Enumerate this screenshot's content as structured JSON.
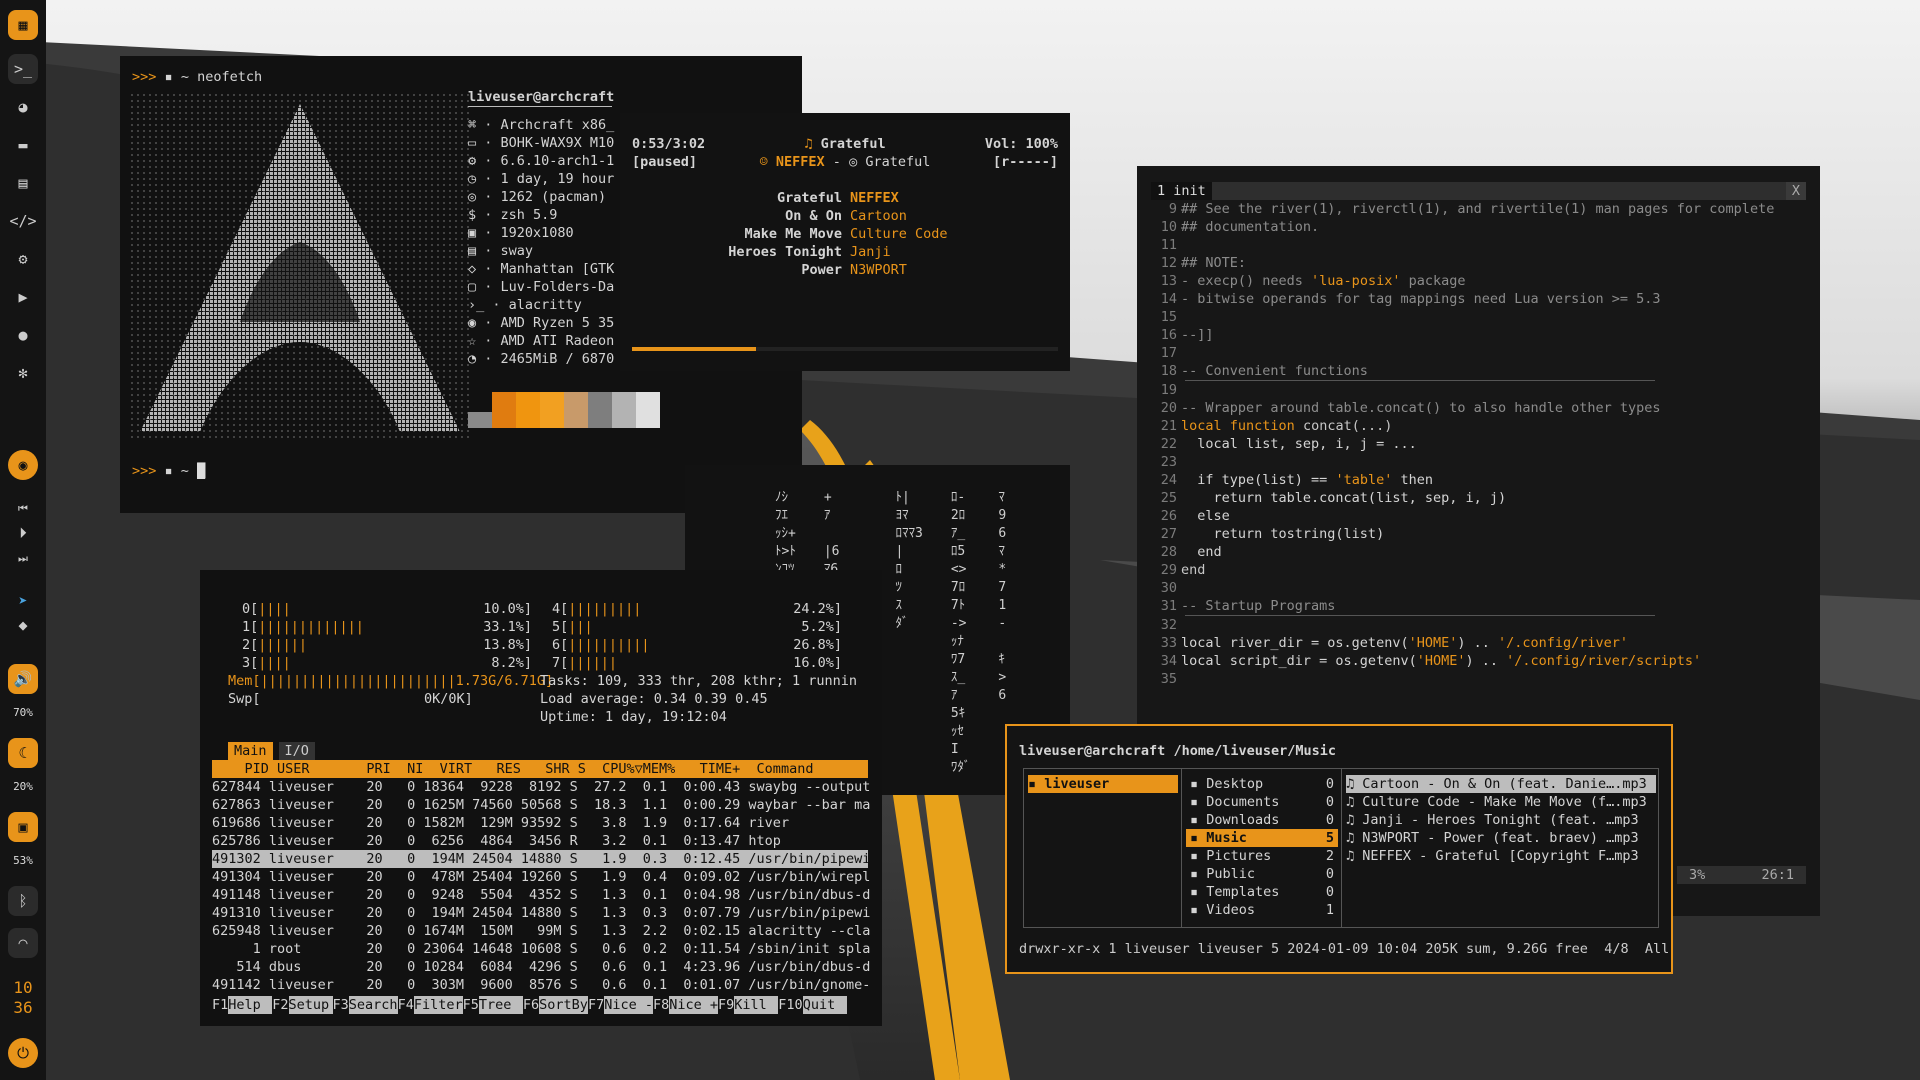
{
  "sidebar": {
    "vol_percent": "70%",
    "bright_percent": "20%",
    "lock_percent": "53%",
    "clock_hour": "10",
    "clock_min": "36",
    "icons": [
      "grid-icon",
      "terminal-icon",
      "firefox-icon",
      "folder-icon",
      "file-icon",
      "code-icon",
      "settings-icon",
      "youtube-icon",
      "github-icon",
      "gear-icon",
      "palette-icon",
      "prev-icon",
      "play-icon",
      "next-icon",
      "telegram-icon",
      "diamond-icon",
      "volume-icon",
      "moon-icon",
      "lock-icon",
      "bluetooth-icon",
      "wifi-icon",
      "power-icon"
    ]
  },
  "neofetch": {
    "prompt": ">>>",
    "cmd": "~ neofetch",
    "host": "liveuser@archcraft",
    "lines": [
      "Archcraft x86_",
      "BOHK-WAX9X M10",
      "6.6.10-arch1-1",
      "1 day, 19 hour",
      "1262 (pacman)",
      "zsh 5.9",
      "1920x1080",
      "sway",
      "Manhattan [GTK",
      "Luv-Folders-Da",
      "alacritty",
      "AMD Ryzen 5 35",
      "AMD ATI Radeon",
      "2465MiB / 6870"
    ],
    "icons": [
      "⌘",
      "▭",
      "⚙",
      "◷",
      "◎",
      "$",
      "▣",
      "▤",
      "◇",
      "▢",
      "›_",
      "◉",
      "☆",
      "◔"
    ],
    "prompt2": ">>> ▪ ~",
    "colors": [
      "#8a8a8a",
      "#e07c10",
      "#f0950f",
      "#f2a021",
      "#c89a6a",
      "#7e7e7e",
      "#b3b3b3",
      "#e0e0e0"
    ]
  },
  "music": {
    "time": "0:53/3:02",
    "state": "[paused]",
    "title": "Grateful",
    "artist": "NEFFEX",
    "album": "Grateful",
    "vol": "Vol: 100%",
    "mode": "[r-----]",
    "tracks": [
      {
        "t": "Grateful",
        "a": "NEFFEX"
      },
      {
        "t": "On & On",
        "a": "Cartoon"
      },
      {
        "t": "Make Me Move",
        "a": "Culture Code"
      },
      {
        "t": "Heroes Tonight",
        "a": "Janji"
      },
      {
        "t": "Power",
        "a": "N3WPORT"
      }
    ],
    "progress": 0.29
  },
  "editor": {
    "tab": "1 init",
    "close": "X",
    "status_pct": "3%",
    "status_pos": "26:1",
    "lines": [
      {
        "n": "9",
        "c": "## See the river(1), riverctl(1), and rivertile(1) man pages for complete",
        "k": "cm"
      },
      {
        "n": "10",
        "c": "## documentation.",
        "k": "cm"
      },
      {
        "n": "11",
        "c": "",
        "k": ""
      },
      {
        "n": "12",
        "c": "## NOTE:",
        "k": "cm"
      },
      {
        "n": "13",
        "c": "- execp() needs 'lua-posix' package",
        "k": "cm"
      },
      {
        "n": "14",
        "c": "- bitwise operands for tag mappings need Lua version >= 5.3",
        "k": "cm"
      },
      {
        "n": "15",
        "c": "",
        "k": ""
      },
      {
        "n": "16",
        "c": "--]]",
        "k": "cm"
      },
      {
        "n": "17",
        "c": "",
        "k": ""
      },
      {
        "n": "18",
        "c": "-- Convenient functions",
        "k": "cm"
      },
      {
        "n": "19",
        "c": "",
        "k": ""
      },
      {
        "n": "20",
        "c": "-- Wrapper around table.concat() to also handle other types",
        "k": "cm"
      },
      {
        "n": "21",
        "c": "local function concat(...)",
        "k": "fn"
      },
      {
        "n": "22",
        "c": "  local list, sep, i, j = ...",
        "k": ""
      },
      {
        "n": "23",
        "c": "",
        "k": ""
      },
      {
        "n": "24",
        "c": "  if type(list) == 'table' then",
        "k": ""
      },
      {
        "n": "25",
        "c": "    return table.concat(list, sep, i, j)",
        "k": ""
      },
      {
        "n": "26",
        "c": "  else",
        "k": ""
      },
      {
        "n": "27",
        "c": "    return tostring(list)",
        "k": ""
      },
      {
        "n": "28",
        "c": "  end",
        "k": ""
      },
      {
        "n": "29",
        "c": "end",
        "k": "kwl"
      },
      {
        "n": "30",
        "c": "",
        "k": ""
      },
      {
        "n": "31",
        "c": "-- Startup Programs",
        "k": "cm"
      },
      {
        "n": "32",
        "c": "",
        "k": ""
      },
      {
        "n": "33",
        "c": "local river_dir = os.getenv('HOME') .. '/.config/river'",
        "k": ""
      },
      {
        "n": "34",
        "c": "local script_dir = os.getenv('HOME') .. '/.config/river/scripts'",
        "k": ""
      },
      {
        "n": "35",
        "c": "",
        "k": ""
      }
    ]
  },
  "matrix": {
    "cols": [
      "ﾉｼ\nﾌｴ\nｯｼ+\nﾄ>ﾄ\nﾝｺﾂ",
      "+\nｱ\n\n|6\nﾏ6",
      "",
      "ﾄ|\nﾖﾏ\nﾛﾏﾏ3\n|\nﾛ\nﾂ\nｽ\nﾀﾞ",
      "ﾛ-\n2ﾛ\nｱ_\nﾛ5\n<>\n7ﾛ\n7ﾄ\n->\nｯﾅ\nﾜ7\nｽ_\nｱ\n5ｷ\nｯｾ\nI\nﾜﾀﾞ",
      "ﾏ\n9\n6\nﾏ\n*\n7\n1\n-\n\nｷ\n>\n6"
    ]
  },
  "htop": {
    "cpus": [
      {
        "id": "0",
        "bar": "||||",
        "pct": "10.0%"
      },
      {
        "id": "1",
        "bar": "|||||||||||||",
        "pct": "33.1%"
      },
      {
        "id": "2",
        "bar": "||||||",
        "pct": "13.8%"
      },
      {
        "id": "3",
        "bar": "||||",
        "pct": "8.2%"
      },
      {
        "id": "4",
        "bar": "|||||||||",
        "pct": "24.2%"
      },
      {
        "id": "5",
        "bar": "|||",
        "pct": "5.2%"
      },
      {
        "id": "6",
        "bar": "||||||||||",
        "pct": "26.8%"
      },
      {
        "id": "7",
        "bar": "||||||",
        "pct": "16.0%"
      }
    ],
    "mem": "Mem[||||||||||||||||||||||||1.73G/6.71G]",
    "swp": "Swp[",
    "swp_val": "0K/0K]",
    "tasks": "Tasks: 109, 333 thr, 208 kthr; 1 runnin",
    "load": "Load average: 0.34 0.39 0.45",
    "uptime": "Uptime: 1 day, 19:12:04",
    "tabs": [
      "Main",
      "I/O"
    ],
    "header": "    PID USER       PRI  NI  VIRT   RES   SHR S  CPU%▽MEM%   TIME+  Command",
    "rows": [
      "627844 liveuser    20   0 18364  9228  8192 S  27.2  0.1  0:00.43 swaybg --output",
      "627863 liveuser    20   0 1625M 74560 50568 S  18.3  1.1  0:00.29 waybar --bar ma",
      "619686 liveuser    20   0 1582M  129M 93592 S   3.8  1.9  0:17.64 river",
      "625786 liveuser    20   0  6256  4864  3456 R   3.2  0.1  0:13.47 htop",
      "491302 liveuser    20   0  194M 24504 14880 S   1.9  0.3  0:12.45 /usr/bin/pipewi",
      "491304 liveuser    20   0  478M 25404 19260 S   1.9  0.4  0:09.02 /usr/bin/wirepl",
      "491148 liveuser    20   0  9248  5504  4352 S   1.3  0.1  0:04.98 /usr/bin/dbus-d",
      "491310 liveuser    20   0  194M 24504 14880 S   1.3  0.3  0:07.79 /usr/bin/pipewi",
      "625948 liveuser    20   0 1674M  150M   99M S   1.3  2.2  0:02.15 alacritty --cla",
      "     1 root        20   0 23064 14648 10608 S   0.6  0.2  0:11.54 /sbin/init spla",
      "   514 dbus        20   0 10284  6084  4296 S   0.6  0.1  4:23.96 /usr/bin/dbus-d",
      "491142 liveuser    20   0  303M  9600  8576 S   0.6  0.1  0:01.07 /usr/bin/gnome-"
    ],
    "fkeys": [
      [
        "F1",
        "Help"
      ],
      [
        "F2",
        "Setup"
      ],
      [
        "F3",
        "Search"
      ],
      [
        "F4",
        "Filter"
      ],
      [
        "F5",
        "Tree"
      ],
      [
        "F6",
        "SortBy"
      ],
      [
        "F7",
        "Nice -"
      ],
      [
        "F8",
        "Nice +"
      ],
      [
        "F9",
        "Kill"
      ],
      [
        "F10",
        "Quit"
      ]
    ]
  },
  "ranger": {
    "user": "liveuser@archcraft",
    "path": "/home/liveuser/Music",
    "left": [
      "liveuser"
    ],
    "mid": [
      {
        "n": "Desktop",
        "c": "0"
      },
      {
        "n": "Documents",
        "c": "0"
      },
      {
        "n": "Downloads",
        "c": "0"
      },
      {
        "n": "Music",
        "c": "5"
      },
      {
        "n": "Pictures",
        "c": "2"
      },
      {
        "n": "Public",
        "c": "0"
      },
      {
        "n": "Templates",
        "c": "0"
      },
      {
        "n": "Videos",
        "c": "1"
      }
    ],
    "right": [
      "Cartoon - On & On (feat. Danie….mp3",
      "Culture Code - Make Me Move (f….mp3",
      "Janji - Heroes Tonight (feat. …mp3",
      "N3WPORT - Power (feat. braev) …mp3",
      "NEFFEX - Grateful [Copyright F…mp3"
    ],
    "status": "drwxr-xr-x 1 liveuser liveuser 5 2024-01-09 10:04 205K sum, 9.26G free  4/8  All"
  }
}
